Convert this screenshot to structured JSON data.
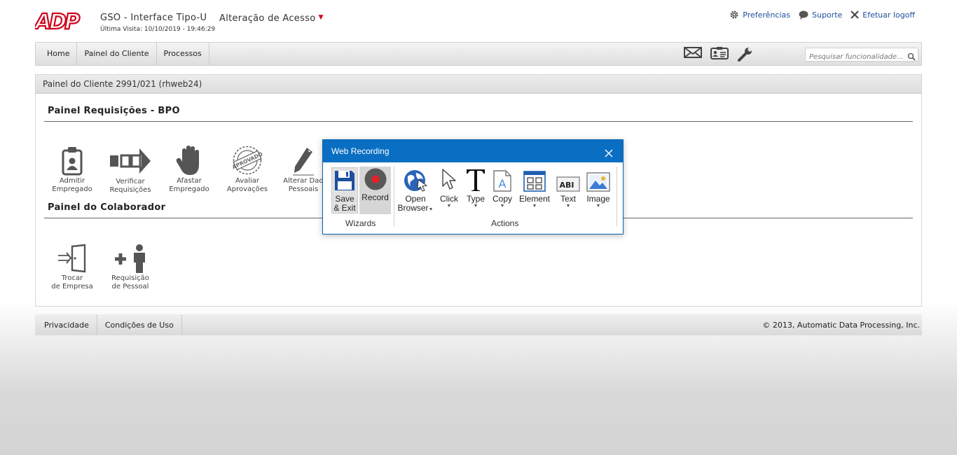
{
  "header": {
    "logo_text": "ADP",
    "app_title": "GSO - Interface Tipo-U",
    "last_visit": "Última Visita: 10/10/2019 - 19:46:29",
    "access_menu": "Alteração de Acesso",
    "links": {
      "preferences": "Preferências",
      "support": "Suporte",
      "logoff": "Efetuar logoff"
    }
  },
  "nav": {
    "items": [
      "Home",
      "Painel do Cliente",
      "Processos"
    ],
    "icons": [
      "mail-icon",
      "contact-card-icon",
      "wrench-icon"
    ],
    "search_placeholder": "Pesquisar funcionalidade..."
  },
  "panel": {
    "title": "Painel do Cliente 2991/021 (rhweb24)",
    "section1": {
      "title": "Painel Requisições - BPO",
      "tiles": [
        {
          "line1": "Admitir",
          "line2": "Empregado",
          "icon": "badge-icon"
        },
        {
          "line1": "Verificar",
          "line2": "Requisições",
          "icon": "process-arrow-icon"
        },
        {
          "line1": "Afastar",
          "line2": "Empregado",
          "icon": "hand-stop-icon"
        },
        {
          "line1": "Avaliar",
          "line2": "Aprovações",
          "icon": "approved-stamp-icon",
          "stamp_text": "APROVADO"
        },
        {
          "line1": "Alterar Dad",
          "line2": "Pessoais",
          "icon": "pen-icon"
        }
      ]
    },
    "section2": {
      "title": "Painel do Colaborador",
      "tiles": [
        {
          "line1": "Trocar",
          "line2": "de Empresa",
          "icon": "door-exit-icon"
        },
        {
          "line1": "Requisição",
          "line2": "de Pessoal",
          "icon": "add-person-icon"
        }
      ]
    }
  },
  "footer": {
    "links": [
      "Privacidade",
      "Condições de Uso"
    ],
    "copyright": "© 2013, Automatic Data Processing, Inc."
  },
  "dialog": {
    "title": "Web Recording",
    "wizards_label": "Wizards",
    "actions_label": "Actions",
    "buttons": {
      "save_exit": [
        "Save",
        "& Exit"
      ],
      "record": "Record",
      "open_browser": [
        "Open",
        "Browser"
      ],
      "click": "Click",
      "type": "Type",
      "copy": "Copy",
      "element": "Element",
      "text": "Text",
      "image": "Image"
    },
    "text_icon_label": "ABI"
  },
  "colors": {
    "adp_red": "#d0021b",
    "link_blue": "#1b4e9b",
    "dialog_blue": "#0a6fc2",
    "record_red": "#e8202a"
  }
}
